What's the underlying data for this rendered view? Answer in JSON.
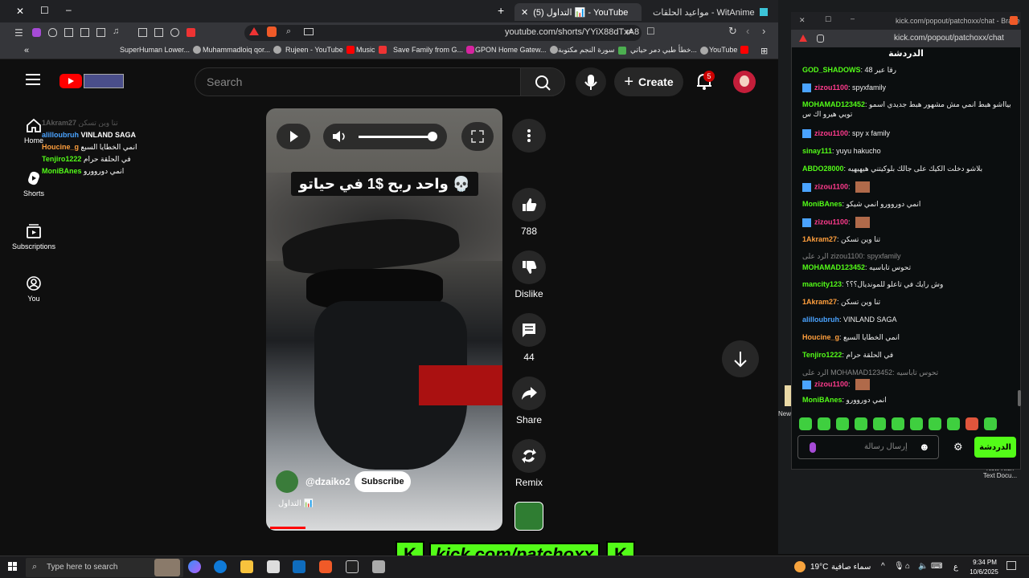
{
  "browser": {
    "tabs": [
      {
        "title": "مواعيد الحلقات - WitAnime",
        "active": false
      },
      {
        "title": "(5) التداول 📊 - YouTube",
        "active": true
      }
    ],
    "url": "youtube.com/shorts/YYiX88dTxA8",
    "bookmarks": [
      "SuperHuman Lower...",
      "Muhammadloiq qor...",
      "Rujeen - YouTube",
      "Music",
      "Save Family from G...",
      "GPON Home Gatew...",
      "سورة النجم مكتوبة",
      "خطأ طبي دمر حياتي...",
      "YouTube"
    ]
  },
  "youtube": {
    "search_placeholder": "Search",
    "create_label": "Create",
    "notification_count": "5",
    "nav": [
      {
        "label": "Home",
        "icon": "home-icon"
      },
      {
        "label": "Shorts",
        "icon": "shorts-icon"
      },
      {
        "label": "Subscriptions",
        "icon": "subscriptions-icon"
      },
      {
        "label": "You",
        "icon": "you-icon"
      }
    ],
    "overlay_chat": [
      {
        "user": "1Akram27",
        "text": "تنا وين تسكن",
        "color": "#888888"
      },
      {
        "user": "alilloubruh",
        "text": "VINLAND SAGA",
        "color": "#4aa3ff"
      },
      {
        "user": "Houcine_g",
        "text": "انمي الخطايا السبع",
        "color": "#ff9f3d"
      },
      {
        "user": "Tenjiro1222",
        "text": "في الحلقة حرام",
        "color": "#53fc18"
      },
      {
        "user": "MoniBAnes",
        "text": "انمي دوروورو",
        "color": "#53fc18"
      }
    ],
    "short": {
      "caption": "واحد ربح $1 في حياتو 💀",
      "channel": "@dzaiko2",
      "subscribe_label": "Subscribe",
      "title": "التداول 📊",
      "progress": 0.15
    },
    "actions": [
      {
        "label": "788",
        "icon": "like-icon"
      },
      {
        "label": "Dislike",
        "icon": "dislike-icon"
      },
      {
        "label": "44",
        "icon": "comment-icon"
      },
      {
        "label": "Share",
        "icon": "share-icon"
      },
      {
        "label": "Remix",
        "icon": "remix-icon"
      }
    ]
  },
  "chat": {
    "window_url": "kick.com/popout/patchoxx/chat - Brave",
    "url": "kick.com/popout/patchoxx/chat",
    "title": "الدردشة",
    "messages": [
      {
        "user": "GOD_SHADOWS",
        "text": "رقا عير 48",
        "color": "#53fc18"
      },
      {
        "user": "zizou1100",
        "text": "spyxfamily",
        "color": "#ff3b8d"
      },
      {
        "user": "MOHAMAD123452",
        "text": "بيااشو هبط انمي مش مشهور هبط جديدي اسمو تويي هيرو اك س",
        "color": "#53fc18"
      },
      {
        "user": "zizou1100",
        "text": "spy x family",
        "color": "#ff3b8d"
      },
      {
        "user": "sinay111",
        "text": "yuyu hakucho",
        "color": "#53fc18"
      },
      {
        "user": "ABDO28000",
        "text": "بلاشو دخلت الكيك على جالك بلوكيتني هيهيهيه",
        "color": "#53fc18"
      },
      {
        "user": "zizou1100",
        "text": "",
        "color": "#ff3b8d"
      },
      {
        "user": "MoniBAnes",
        "text": "انمي دوروورو انمي شيكو",
        "color": "#53fc18"
      },
      {
        "user": "zizou1100",
        "text": "",
        "color": "#ff3b8d"
      },
      {
        "user": "1Akram27",
        "text": "تنا وين تسكن",
        "color": "#ff9f3d"
      },
      {
        "user": "",
        "text": "الرد على zizou1100: spyxfamily",
        "color": "#888888"
      },
      {
        "user": "MOHAMAD123452",
        "text": "تحوس تاباسيه",
        "color": "#53fc18"
      },
      {
        "user": "mancity123",
        "text": "وش رايك في تاعلو للمونديال؟؟؟",
        "color": "#53fc18"
      },
      {
        "user": "1Akram27",
        "text": "تنا وين تسكن",
        "color": "#ff9f3d"
      },
      {
        "user": "alilloubruh",
        "text": "VINLAND SAGA",
        "color": "#4aa3ff"
      },
      {
        "user": "Houcine_g",
        "text": "انمي الخطايا السبع",
        "color": "#ff9f3d"
      },
      {
        "user": "Tenjiro1222",
        "text": "في الحلقة حرام",
        "color": "#53fc18"
      },
      {
        "user": "",
        "text": "الرد على MOHAMAD123452: تحوس تاباسيه",
        "color": "#888888"
      },
      {
        "user": "zizou1100",
        "text": "",
        "color": "#ff3b8d"
      },
      {
        "user": "MoniBAnes",
        "text": "انمي دوروورو",
        "color": "#53fc18"
      }
    ],
    "input_placeholder": "إرسال رسالة",
    "send_label": "الدردشة"
  },
  "desktop": {
    "icon_label_new": "New",
    "icon_label_doc": "New Rich Text Docu..."
  },
  "taskbar": {
    "search_placeholder": "Type here to search",
    "weather_temp": "19°C",
    "weather_text": "سماء صافية",
    "time": "9:34 PM",
    "date": "10/6/2025",
    "lang": "ع"
  },
  "kick_banner": "kick.com/patchoxx",
  "colors": {
    "kick_green": "#53fc18",
    "yt_red": "#ff0000"
  }
}
